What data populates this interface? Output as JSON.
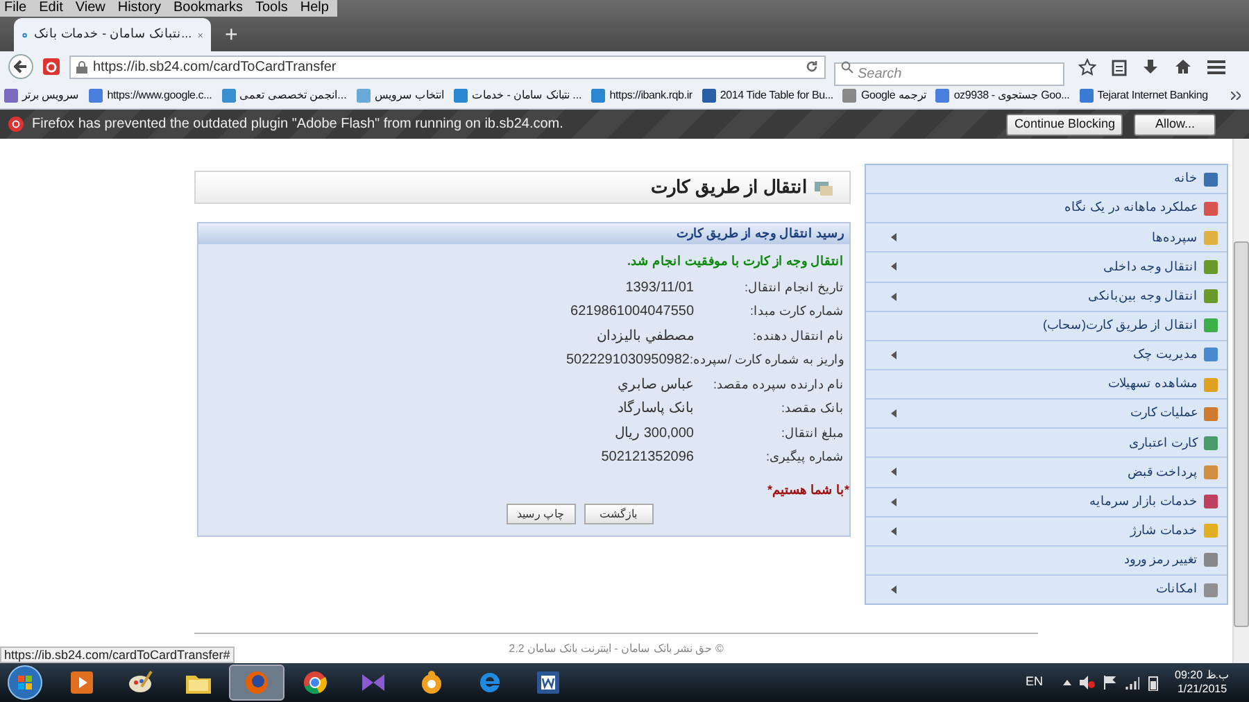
{
  "browser": {
    "menu": [
      "Help",
      "Tools",
      "Bookmarks",
      "History",
      "View",
      "Edit",
      "File"
    ],
    "tabs": [
      {
        "title": "...نتبانک سامان - خدمات بانک",
        "selected": true
      }
    ],
    "new_tab": "+",
    "url": "https://ib.sb24.com/cardToCardTransfer",
    "search": {
      "placeholder": "Search"
    },
    "bookmarks": [
      "Tejarat Internet Banking",
      "oz9938 - جستجوی Goo...",
      "ترجمه Google",
      "2014 Tide Table for Bu...",
      "https://ibank.rqb.ir",
      "... نتبانک سامان - خدمات",
      "انتخاب سرویس",
      "...انجمن تخصصی تعمی",
      "https://www.google.c...",
      "سرویس برتر"
    ],
    "notification": {
      "text": "Firefox has prevented the outdated plugin \"Adobe Flash\" from running on ib.sb24.com.",
      "buttons": [
        "Allow...",
        "Continue Blocking"
      ]
    }
  },
  "page": {
    "title": "انتقال از طریق کارت",
    "receipt": {
      "heading": "رسید انتقال وجه از طریق کارت",
      "message": "انتقال وجه از کارت با موفقیت انجام شد.",
      "fields": [
        {
          "label": "تاریخ انجام انتقال:",
          "value": "1393/11/01"
        },
        {
          "label": "شماره کارت مبدا:",
          "value": "6219861004047550"
        },
        {
          "label": "نام انتقال دهنده:",
          "value": "مصطفي باليزدان"
        },
        {
          "label": "واریز به شماره کارت /سپرده:",
          "value": "5022291030950982"
        },
        {
          "label": "نام دارنده سپرده مقصد:",
          "value": "عباس صابري"
        },
        {
          "label": "بانک مقصد:",
          "value": "بانک پاسارگاد"
        },
        {
          "label": "مبلغ انتقال:",
          "value": "300,000 ریال"
        },
        {
          "label": "شماره پیگیری:",
          "value": "502121352096"
        }
      ],
      "slogan": "*با شما هستیم*",
      "buttons": [
        "بازگشت",
        "چاپ رسید"
      ]
    },
    "sidebar": {
      "items": [
        {
          "label": "خانه",
          "has_submenu": false
        },
        {
          "label": "عملکرد ماهانه در یک نگاه",
          "has_submenu": false
        },
        {
          "label": "سپرده‌ها",
          "has_submenu": true
        },
        {
          "label": "انتقال وجه داخلی",
          "has_submenu": true
        },
        {
          "label": "انتقال وجه بین‌بانکی",
          "has_submenu": true
        },
        {
          "label": "انتقال از طریق کارت(سحاب)",
          "has_submenu": false
        },
        {
          "label": "مدیریت چک",
          "has_submenu": true
        },
        {
          "label": "مشاهده تسهیلات",
          "has_submenu": false
        },
        {
          "label": "عملیات کارت",
          "has_submenu": true
        },
        {
          "label": "کارت اعتباری",
          "has_submenu": false
        },
        {
          "label": "پرداخت قبض",
          "has_submenu": true
        },
        {
          "label": "خدمات بازار سرمایه",
          "has_submenu": true
        },
        {
          "label": "خدمات شارژ",
          "has_submenu": true
        },
        {
          "label": "تغییر رمز ورود",
          "has_submenu": false
        },
        {
          "label": "امکانات",
          "has_submenu": true
        }
      ]
    },
    "footer": "© حق نشر بانک سامان - اینترنت بانک سامان 2.2"
  },
  "status_link": "https://ib.sb24.com/cardToCardTransfer#",
  "taskbar": {
    "apps": [
      {
        "kind": "media",
        "active": false
      },
      {
        "kind": "paint",
        "active": false
      },
      {
        "kind": "folder",
        "active": false
      },
      {
        "kind": "firefox",
        "active": true
      },
      {
        "kind": "chrome",
        "active": false
      },
      {
        "kind": "studio",
        "active": false
      },
      {
        "kind": "orb",
        "active": false
      },
      {
        "kind": "ie",
        "active": false
      },
      {
        "kind": "word",
        "active": false
      }
    ],
    "language": "EN",
    "time": "09:20 ب.ظ",
    "date": "1/21/2015"
  }
}
